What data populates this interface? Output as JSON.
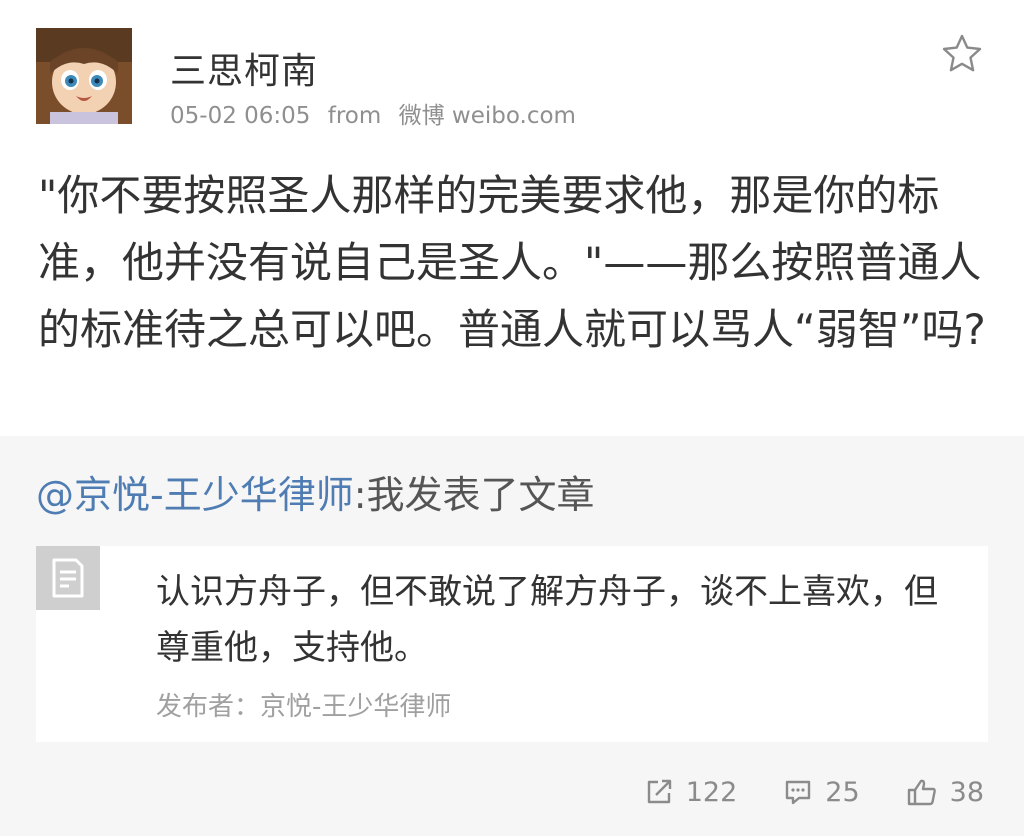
{
  "post": {
    "author": "三思柯南",
    "timestamp": "05-02 06:05",
    "source_prefix": "from",
    "source": "微博 weibo.com",
    "text": "\"你不要按照圣人那样的完美要求他，那是你的标准，他并没有说自己是圣人。\"——那么按照普通人的标准待之总可以吧。普通人就可以骂人“弱智”吗?"
  },
  "repost": {
    "mention": "@京悦-王少华律师",
    "text": ":我发表了文章",
    "article": {
      "excerpt": "认识方舟子，但不敢说了解方舟子，谈不上喜欢，但尊重他，支持他。",
      "publisher": "发布者：京悦-王少华律师"
    }
  },
  "actions": {
    "repost_count": "122",
    "comment_count": "25",
    "like_count": "38"
  },
  "icons": {
    "favorite": "star-icon",
    "article": "document-icon",
    "repost": "share-icon",
    "comment": "comment-icon",
    "like": "thumbs-up-icon"
  },
  "colors": {
    "link": "#4f7db3",
    "secondary_text": "#8f8f8f",
    "repost_background": "#f6f6f6",
    "article_icon_background": "#cfcfcf"
  }
}
